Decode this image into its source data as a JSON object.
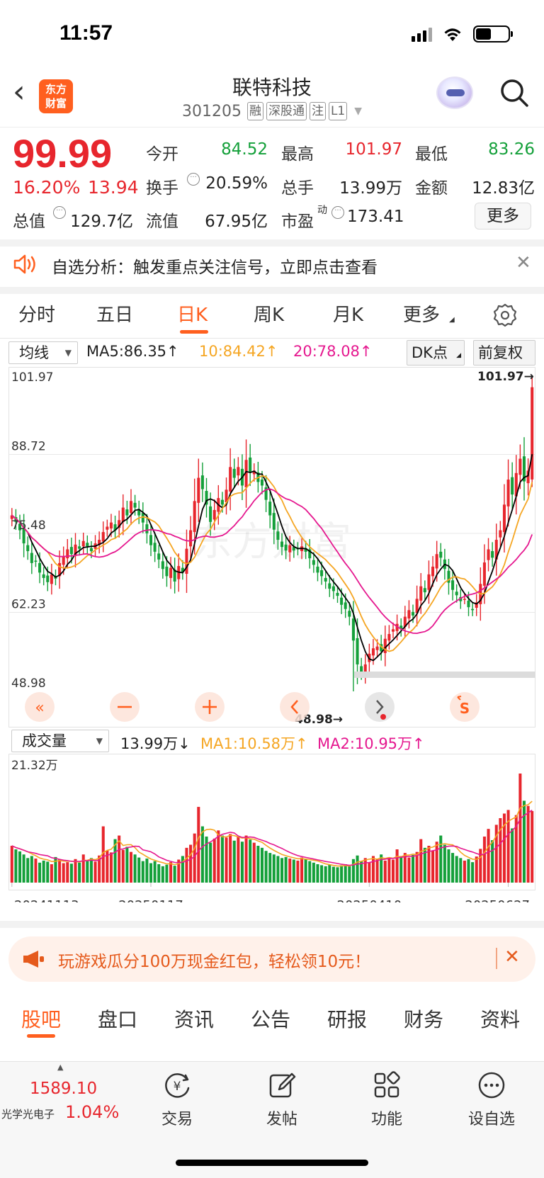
{
  "status": {
    "time": "11:57"
  },
  "header": {
    "title": "联特科技",
    "code": "301205",
    "tags": [
      "融",
      "深股通",
      "注",
      "L1"
    ],
    "logo_text_1": "东方",
    "logo_text_2": "财富"
  },
  "quote": {
    "price": "99.99",
    "change_pct": "16.20%",
    "change": "13.94",
    "rows": [
      [
        {
          "label": "今开",
          "value": "84.52",
          "color": "green"
        },
        {
          "label": "最高",
          "value": "101.97",
          "color": "red"
        },
        {
          "label": "最低",
          "value": "83.26",
          "color": "green"
        }
      ],
      [
        {
          "label": "换手",
          "value": "20.59%",
          "color": "black"
        },
        {
          "label": "总手",
          "value": "13.99万",
          "color": "black"
        },
        {
          "label": "金额",
          "value": "12.83亿",
          "color": "black"
        }
      ],
      [
        {
          "label": "总值",
          "value": "129.7亿",
          "color": "black"
        },
        {
          "label": "流值",
          "value": "67.95亿",
          "color": "black"
        },
        {
          "label": "市盈",
          "value": "173.41",
          "color": "black"
        }
      ]
    ],
    "pe_superscript": "动",
    "more_label": "更多"
  },
  "alert": {
    "text": "自选分析：触发重点关注信号，立即点击查看"
  },
  "period_tabs": [
    "分时",
    "五日",
    "日K",
    "周K",
    "月K",
    "更多"
  ],
  "period_active": "日K",
  "chart_header": {
    "indicator_select": "均线",
    "ma5": "MA5:86.35↑",
    "ma10": "10:84.42↑",
    "ma20": "20:78.08↑",
    "dk_label": "DK点",
    "adjust_label": "前复权"
  },
  "volume_header": {
    "select": "成交量",
    "vol": "13.99万↓",
    "ma1": "MA1:10.58万↑",
    "ma2": "MA2:10.95万↑"
  },
  "chart_data": {
    "type": "candlestick",
    "y_axis_labels": [
      "101.97",
      "88.72",
      "75.48",
      "62.23",
      "48.98"
    ],
    "ylim": [
      48.98,
      101.97
    ],
    "high_marker": "101.97",
    "low_marker": "48.98",
    "volume_axis_label": "21.32万",
    "volume_max": 21.32,
    "x_tick_labels": [
      "20241113",
      "20250117",
      "20250410",
      "20250627"
    ],
    "watermark": "东方财富",
    "colors": {
      "up": "#e7262d",
      "down": "#14a03a",
      "ma5": "#000000",
      "ma10": "#f5a623",
      "ma20": "#e5188f"
    },
    "close": [
      78.5,
      77.4,
      76.0,
      73.8,
      72.5,
      70.5,
      70.8,
      68.9,
      68.0,
      67.3,
      68.6,
      67.9,
      70.5,
      71.6,
      72.8,
      72.0,
      73.6,
      72.9,
      74.2,
      73.3,
      72.5,
      73.8,
      74.4,
      75.7,
      76.6,
      77.3,
      76.0,
      77.7,
      79.8,
      78.5,
      80.9,
      79.8,
      78.5,
      77.3,
      75.5,
      73.5,
      72.4,
      71.1,
      69.5,
      68.3,
      69.7,
      67.4,
      70.0,
      69.0,
      72.9,
      76.0,
      80.9,
      84.8,
      82.9,
      80.3,
      77.4,
      79.4,
      81.4,
      80.3,
      82.8,
      86.6,
      84.8,
      86.6,
      83.5,
      87.8,
      85.7,
      86.0,
      84.1,
      83.5,
      81.1,
      78.5,
      76.1,
      74.4,
      73.2,
      72.6,
      73.5,
      72.6,
      72.8,
      73.3,
      72.4,
      71.3,
      70.2,
      68.9,
      68.3,
      67.4,
      66.2,
      65.8,
      65.0,
      63.5,
      62.8,
      61.5,
      57.5,
      53.5,
      52.3,
      53.5,
      55.3,
      56.2,
      56.5,
      55.7,
      57.8,
      58.6,
      59.4,
      60.3,
      59.4,
      61.5,
      62.6,
      61.7,
      64.5,
      66.6,
      65.6,
      68.6,
      69.9,
      72.0,
      71.4,
      69.5,
      67.2,
      66.0,
      65.1,
      64.1,
      64.5,
      63.1,
      62.6,
      63.9,
      67.0,
      70.6,
      72.8,
      71.4,
      74.4,
      76.0,
      80.3,
      84.5,
      82.0,
      85.6,
      88.0,
      84.2,
      86.0,
      99.99
    ],
    "volume": [
      7.2,
      6.5,
      6.1,
      5.5,
      4.8,
      5.2,
      4.7,
      3.9,
      4.3,
      4.1,
      3.6,
      5.0,
      4.5,
      3.8,
      4.0,
      3.7,
      4.6,
      3.9,
      5.5,
      4.2,
      4.8,
      4.1,
      5.3,
      11.0,
      6.3,
      5.9,
      8.5,
      9.2,
      6.4,
      7.0,
      6.0,
      5.5,
      4.9,
      4.2,
      4.7,
      3.8,
      4.2,
      3.6,
      3.2,
      3.5,
      4.0,
      3.3,
      4.5,
      5.2,
      6.8,
      7.4,
      9.6,
      14.8,
      11.0,
      9.0,
      7.8,
      8.6,
      10.2,
      9.2,
      8.8,
      9.5,
      8.2,
      9.0,
      8.0,
      9.2,
      8.4,
      7.8,
      7.2,
      6.8,
      6.2,
      5.8,
      5.5,
      5.2,
      4.8,
      5.0,
      4.7,
      4.5,
      4.3,
      4.9,
      4.6,
      4.2,
      3.9,
      3.6,
      3.4,
      3.2,
      3.5,
      3.1,
      3.0,
      3.4,
      3.6,
      3.2,
      4.6,
      5.3,
      4.2,
      4.8,
      4.0,
      5.2,
      4.7,
      5.5,
      4.3,
      4.8,
      4.5,
      6.5,
      5.2,
      5.8,
      4.9,
      5.4,
      6.0,
      8.5,
      6.8,
      7.2,
      6.2,
      8.0,
      9.2,
      7.4,
      6.5,
      5.8,
      5.2,
      4.8,
      4.3,
      4.6,
      4.0,
      5.1,
      6.6,
      9.0,
      10.5,
      8.3,
      11.3,
      12.6,
      13.5,
      14.2,
      10.6,
      13.2,
      21.32,
      16.0,
      15.0,
      13.99
    ]
  },
  "ad": {
    "text": "玩游戏瓜分100万现金红包，轻松领10元！"
  },
  "bottom_tabs": [
    "股吧",
    "盘口",
    "资讯",
    "公告",
    "研报",
    "财务",
    "资料"
  ],
  "bottom_active": "股吧",
  "bottom_bar": {
    "index_value": "1589.10",
    "index_name": "光学光电子",
    "index_pct": "1.04%",
    "items": [
      "交易",
      "发帖",
      "功能",
      "设自选"
    ]
  }
}
